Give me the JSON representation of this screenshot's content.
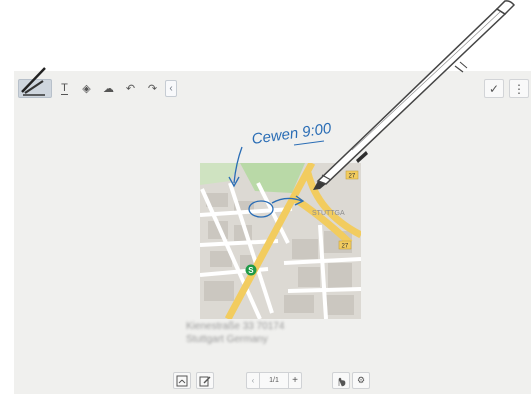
{
  "toolbar": {
    "tools": [
      {
        "name": "pen-tool",
        "icon": "pen-icon",
        "active": true
      },
      {
        "name": "text-tool",
        "icon": "text-icon",
        "glyph": "T"
      },
      {
        "name": "eraser-tool",
        "icon": "eraser-icon",
        "glyph": "◈"
      },
      {
        "name": "lasso-tool",
        "icon": "cloud-lasso-icon",
        "glyph": "☁"
      },
      {
        "name": "undo-tool",
        "icon": "undo-icon",
        "glyph": "↶"
      },
      {
        "name": "redo-tool",
        "icon": "redo-icon",
        "glyph": "↷"
      },
      {
        "name": "collapse-tool",
        "icon": "chevron-left-icon",
        "glyph": "‹"
      }
    ],
    "done_glyph": "✓",
    "more_glyph": "⋮"
  },
  "note": {
    "handwriting": "Cewen 9:00"
  },
  "map": {
    "area_label": "STUTTGA",
    "road_number": "27",
    "transit_glyph": "S"
  },
  "address": {
    "line1": "Kienestraße 33 70174",
    "line2": "Stuttgart Germany"
  },
  "bottom_bar": {
    "page_prev_glyph": "‹",
    "page_indicator": "1/1",
    "page_add_glyph": "+"
  },
  "colors": {
    "canvas": "#f0f0ee",
    "ink": "#2a6db5",
    "road_major": "#f2cc5f",
    "park": "#b9d9a7"
  }
}
